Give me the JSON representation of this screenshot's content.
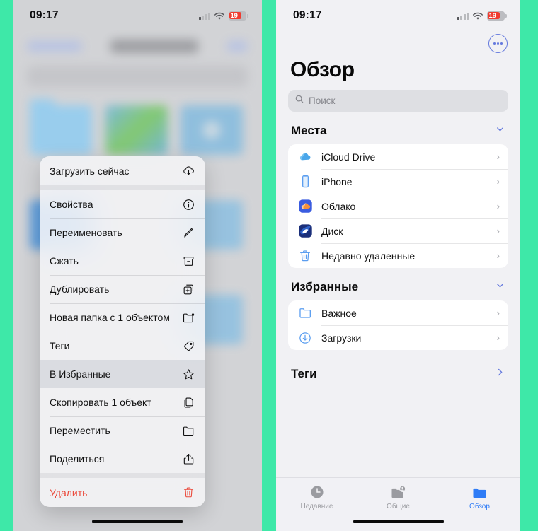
{
  "background_color": "#3EE8A8",
  "left_phone": {
    "status_bar": {
      "time": "09:17",
      "battery": "19"
    },
    "context_menu": {
      "items": [
        {
          "label": "Загрузить сейчас",
          "icon": "cloud-download-icon",
          "separator_after": true,
          "highlighted": false,
          "danger": false
        },
        {
          "label": "Свойства",
          "icon": "info-circle-icon",
          "separator_after": false,
          "highlighted": false,
          "danger": false
        },
        {
          "label": "Переименовать",
          "icon": "pencil-icon",
          "separator_after": false,
          "highlighted": false,
          "danger": false
        },
        {
          "label": "Сжать",
          "icon": "archive-box-icon",
          "separator_after": false,
          "highlighted": false,
          "danger": false
        },
        {
          "label": "Дублировать",
          "icon": "duplicate-icon",
          "separator_after": false,
          "highlighted": false,
          "danger": false
        },
        {
          "label": "Новая папка с 1 объектом",
          "icon": "new-folder-icon",
          "separator_after": false,
          "highlighted": false,
          "danger": false
        },
        {
          "label": "Теги",
          "icon": "tag-icon",
          "separator_after": false,
          "highlighted": false,
          "danger": false
        },
        {
          "label": "В Избранные",
          "icon": "star-icon",
          "separator_after": false,
          "highlighted": true,
          "danger": false
        },
        {
          "label": "Скопировать 1 объект",
          "icon": "copy-icon",
          "separator_after": false,
          "highlighted": false,
          "danger": false
        },
        {
          "label": "Переместить",
          "icon": "folder-icon",
          "separator_after": false,
          "highlighted": false,
          "danger": false
        },
        {
          "label": "Поделиться",
          "icon": "share-icon",
          "separator_after": true,
          "highlighted": false,
          "danger": false
        },
        {
          "label": "Удалить",
          "icon": "trash-icon",
          "separator_after": false,
          "highlighted": false,
          "danger": true
        }
      ],
      "danger_color": "#EB4B3C"
    }
  },
  "right_phone": {
    "status_bar": {
      "time": "09:17",
      "battery": "19"
    },
    "more_button": "more-options-icon",
    "title": "Обзор",
    "search": {
      "placeholder": "Поиск",
      "value": ""
    },
    "sections": [
      {
        "title": "Места",
        "chevron": "chevron-down-icon",
        "items": [
          {
            "label": "iCloud Drive",
            "icon": "icloud-icon"
          },
          {
            "label": "iPhone",
            "icon": "iphone-icon"
          },
          {
            "label": "Облако",
            "icon": "mailru-cloud-icon"
          },
          {
            "label": "Диск",
            "icon": "yandex-disk-icon"
          },
          {
            "label": "Недавно удаленные",
            "icon": "trash-icon"
          }
        ]
      },
      {
        "title": "Избранные",
        "chevron": "chevron-down-icon",
        "items": [
          {
            "label": "Важное",
            "icon": "folder-icon"
          },
          {
            "label": "Загрузки",
            "icon": "download-circle-icon"
          }
        ]
      },
      {
        "title": "Теги",
        "chevron": "chevron-right-icon",
        "items": []
      }
    ],
    "tabbar": {
      "accent_color": "#2F7CF6",
      "tabs": [
        {
          "label": "Недавние",
          "icon": "clock-icon",
          "active": false
        },
        {
          "label": "Общие",
          "icon": "shared-folder-icon",
          "active": false
        },
        {
          "label": "Обзор",
          "icon": "folder-fill-icon",
          "active": true
        }
      ]
    }
  }
}
